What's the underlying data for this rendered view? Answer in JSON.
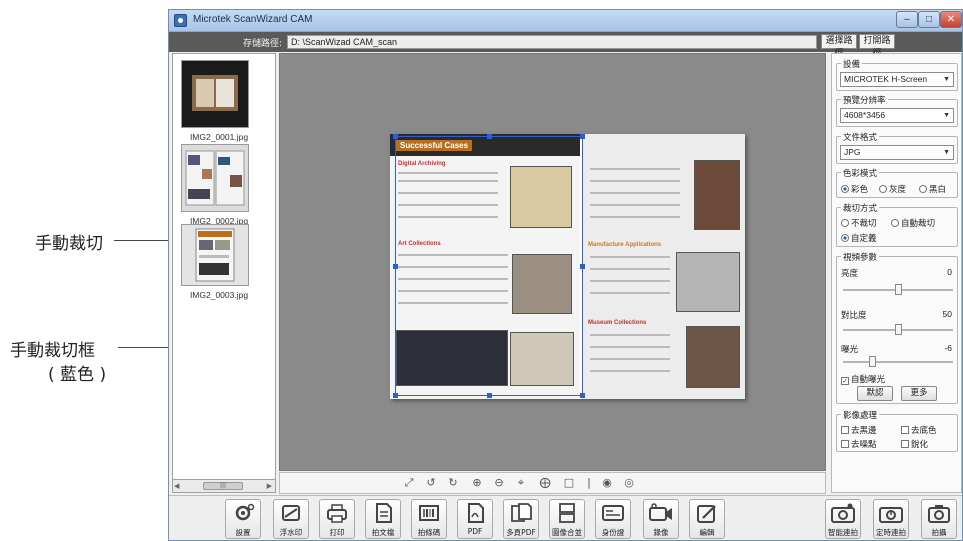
{
  "annotations": {
    "manual_crop": "手動裁切",
    "manual_crop_frame": "手動裁切框",
    "blue_note": "( 藍色 )"
  },
  "window": {
    "title": "Microtek ScanWizard CAM"
  },
  "path_bar": {
    "label": "存儲路徑:",
    "value": "D: \\ScanWizad CAM_scan",
    "select_path": "選擇路徑",
    "open_path": "打開路徑"
  },
  "thumbnails": [
    {
      "name": "IMG2_0001.jpg"
    },
    {
      "name": "IMG2_0002.jpg"
    },
    {
      "name": "IMG2_0003.jpg"
    }
  ],
  "preview": {
    "doc_title": "Successful Cases",
    "sections_left": [
      "Digital Archiving",
      "Art Collections"
    ],
    "sections_right": [
      "Manufacture Applications",
      "Museum Collections"
    ]
  },
  "settings": {
    "device": {
      "title": "設備",
      "value": "MICROTEK H-Screen"
    },
    "preview_resolution": {
      "title": "預覽分辨率",
      "value": "4608*3456"
    },
    "file_format": {
      "title": "文件格式",
      "value": "JPG"
    },
    "color_mode": {
      "title": "色彩模式",
      "options": [
        "彩色",
        "灰度",
        "黑白"
      ],
      "selected": 0
    },
    "crop_mode": {
      "title": "裁切方式",
      "options": [
        "不裁切",
        "自動裁切",
        "自定義"
      ],
      "selected": 2
    },
    "video_params": {
      "title": "視頻參數",
      "brightness": {
        "label": "亮度",
        "value": "0",
        "level": 0.5
      },
      "contrast": {
        "label": "對比度",
        "value": "50",
        "level": 0.5
      },
      "exposure": {
        "label": "曝光",
        "value": "-6",
        "level": 0.25
      },
      "auto_exposure": "自動曝光",
      "default_btn": "默認",
      "more_btn": "更多"
    },
    "image_processing": {
      "title": "影像處理",
      "options": [
        "去黑邊",
        "去底色",
        "去噪點",
        "銳化"
      ]
    }
  },
  "toolbar": {
    "left": [
      "設置",
      "浮水印",
      "打印",
      "拍文檔",
      "拍條碼",
      "PDF",
      "多頁PDF",
      "圖像合並",
      "身份證",
      "錄像",
      "編輯"
    ],
    "right": [
      "智能連拍",
      "定時連拍",
      "拍攝"
    ]
  }
}
